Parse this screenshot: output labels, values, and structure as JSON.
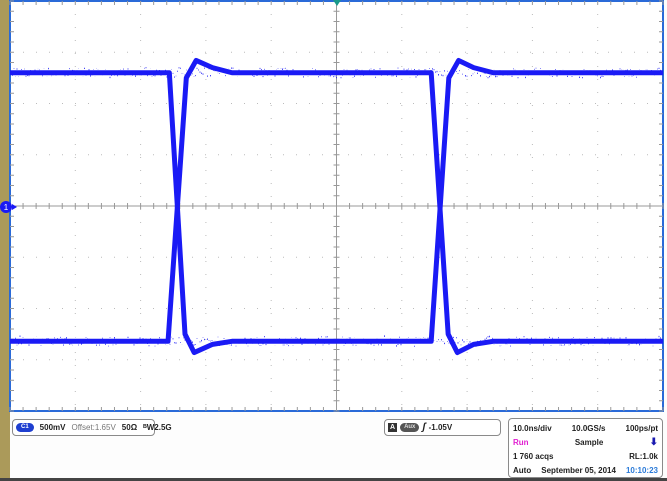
{
  "channel": {
    "badge": "C1",
    "scale": "500mV",
    "offset": "Offset:1.65V",
    "impedance": "50Ω",
    "bandwidth": "2.5G",
    "bandwidth_icon": "bandwidth-limit-icon"
  },
  "trigger": {
    "label": "A",
    "source": "Aux",
    "slope_icon": "rising-edge-icon",
    "level": "-1.05V"
  },
  "timebase": {
    "time_div": "10.0ns/div",
    "sample_rate": "10.0GS/s",
    "resolution": "100ps/pt",
    "state": "Run",
    "mode": "Sample",
    "acqs": "1 760 acqs",
    "record_length": "RL:1.0k",
    "trigger_mode": "Auto",
    "date": "September 05, 2014",
    "time": "10:10:23"
  },
  "colors": {
    "trace": "#1a1af5",
    "graticule_border": "#2a6ad8",
    "run": "#e020d0",
    "time": "#2a7ad8"
  },
  "chart_data": {
    "type": "line",
    "title": "",
    "xlabel": "",
    "ylabel": "",
    "x_units": "ns",
    "y_units": "V",
    "xlim": [
      -50,
      50
    ],
    "ylim": [
      -0.35,
      3.65
    ],
    "x_divisions": 10,
    "y_divisions": 8,
    "grid": true,
    "series": [
      {
        "x": [
          -50,
          -25.8,
          -23,
          -21.5,
          -19,
          -16,
          14.5,
          17.1,
          18.5,
          21,
          24,
          50
        ],
        "y": [
          0.33,
          0.33,
          2.9,
          3.07,
          3.0,
          2.95,
          2.95,
          0.4,
          0.22,
          0.3,
          0.33,
          0.33
        ]
      },
      {
        "x": [
          -50,
          -25.6,
          -23.2,
          -21.8,
          -19,
          -16,
          14.5,
          17.2,
          18.7,
          21,
          24,
          50
        ],
        "y": [
          2.95,
          2.95,
          0.4,
          0.22,
          0.3,
          0.33,
          0.33,
          2.9,
          3.07,
          3.0,
          2.95,
          2.95
        ]
      }
    ]
  }
}
